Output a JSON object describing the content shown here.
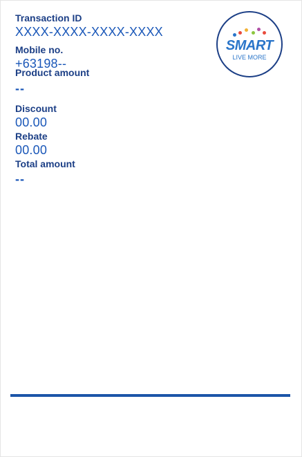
{
  "transaction": {
    "id_label": "Transaction ID",
    "id_value": "XXXX-XXXX-XXXX-XXXX",
    "mobile_label": "Mobile no.",
    "mobile_value": "+63198--",
    "product_label": "Product amount",
    "product_value": "--",
    "discount_label": "Discount",
    "discount_value": "00.00",
    "rebate_label": "Rebate",
    "rebate_value": "00.00",
    "total_label": "Total amount",
    "total_value": "--"
  },
  "logo": {
    "word": "SMART",
    "tagline": "LIVE MORE",
    "icon": "smart-logo-icon",
    "dot_colors": [
      "#e94b3c",
      "#f2b134",
      "#8cc63f",
      "#2a75c9",
      "#b04fa6"
    ]
  },
  "colors": {
    "label": "#1c3f86",
    "value": "#1a57b8",
    "divider": "#1c55a8"
  }
}
